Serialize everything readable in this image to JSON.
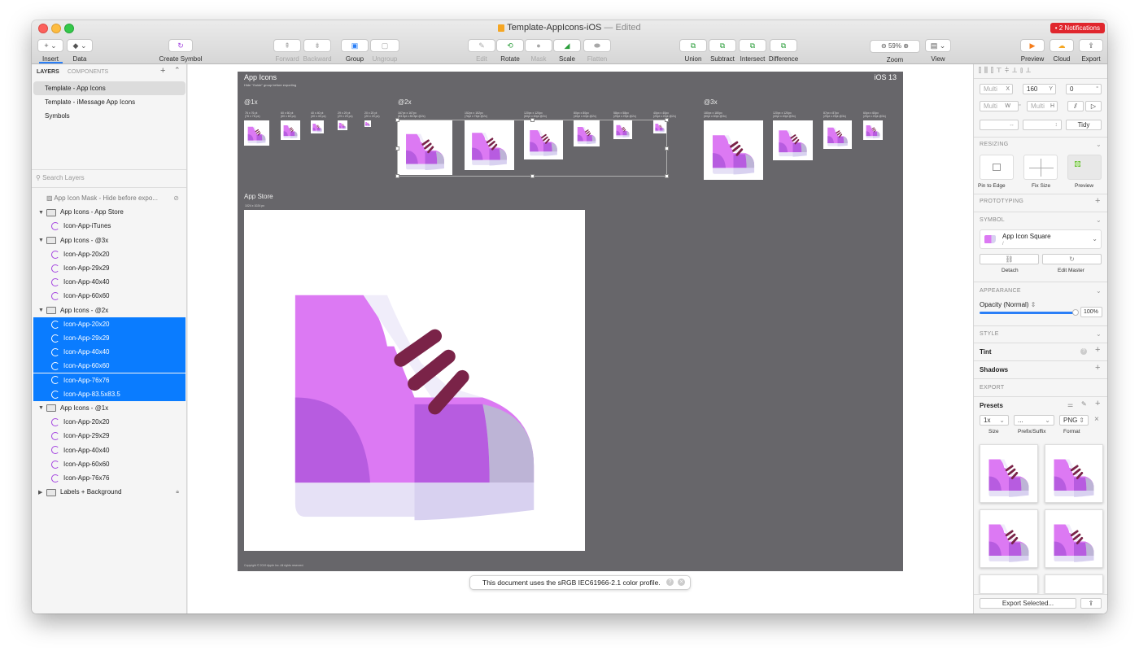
{
  "window": {
    "title": "Template-AppIcons-iOS",
    "edited": "— Edited",
    "notifications": "• 2 Notifications"
  },
  "toolbar": {
    "insert": "Insert",
    "data": "Data",
    "create_symbol": "Create Symbol",
    "forward": "Forward",
    "backward": "Backward",
    "group": "Group",
    "ungroup": "Ungroup",
    "edit": "Edit",
    "rotate": "Rotate",
    "mask": "Mask",
    "scale": "Scale",
    "flatten": "Flatten",
    "union": "Union",
    "subtract": "Subtract",
    "intersect": "Intersect",
    "difference": "Difference",
    "zoom_value": "59%",
    "zoom": "Zoom",
    "view": "View",
    "preview": "Preview",
    "cloud": "Cloud",
    "export": "Export"
  },
  "left": {
    "tab_layers": "LAYERS",
    "tab_components": "COMPONENTS",
    "pages": [
      "Template - App Icons",
      "Template - iMessage App Icons",
      "Symbols"
    ],
    "search_placeholder": "Search Layers",
    "layers": [
      {
        "label": "App Icon Mask - Hide before expo...",
        "kind": "mask",
        "indent": 0
      },
      {
        "label": "App Icons - App Store",
        "kind": "group",
        "indent": 0
      },
      {
        "label": "Icon-App-iTunes",
        "kind": "symbol",
        "indent": 1
      },
      {
        "label": "App Icons - @3x",
        "kind": "group",
        "indent": 0
      },
      {
        "label": "Icon-App-20x20",
        "kind": "symbol",
        "indent": 1
      },
      {
        "label": "Icon-App-29x29",
        "kind": "symbol",
        "indent": 1
      },
      {
        "label": "Icon-App-40x40",
        "kind": "symbol",
        "indent": 1
      },
      {
        "label": "Icon-App-60x60",
        "kind": "symbol",
        "indent": 1
      },
      {
        "label": "App Icons - @2x",
        "kind": "group",
        "indent": 0
      },
      {
        "label": "Icon-App-20x20",
        "kind": "symbol",
        "indent": 1,
        "selected": true
      },
      {
        "label": "Icon-App-29x29",
        "kind": "symbol",
        "indent": 1,
        "selected": true
      },
      {
        "label": "Icon-App-40x40",
        "kind": "symbol",
        "indent": 1,
        "selected": true
      },
      {
        "label": "Icon-App-60x60",
        "kind": "symbol",
        "indent": 1,
        "selected": true
      },
      {
        "label": "Icon-App-76x76",
        "kind": "symbol",
        "indent": 1,
        "selected": true
      },
      {
        "label": "Icon-App-83.5x83.5",
        "kind": "symbol",
        "indent": 1,
        "selected": true
      },
      {
        "label": "App Icons - @1x",
        "kind": "group",
        "indent": 0
      },
      {
        "label": "Icon-App-20x20",
        "kind": "symbol",
        "indent": 1
      },
      {
        "label": "Icon-App-29x29",
        "kind": "symbol",
        "indent": 1
      },
      {
        "label": "Icon-App-40x40",
        "kind": "symbol",
        "indent": 1
      },
      {
        "label": "Icon-App-60x60",
        "kind": "symbol",
        "indent": 1
      },
      {
        "label": "Icon-App-76x76",
        "kind": "symbol",
        "indent": 1
      },
      {
        "label": "Labels + Background",
        "kind": "group-closed",
        "indent": 0
      }
    ]
  },
  "canvas": {
    "artboard_title": "App Icons",
    "artboard_hint": "Hide \"Guide\" group before exporting",
    "ios": "iOS 13",
    "sec_1x": "@1x",
    "sec_2x": "@2x",
    "sec_3x": "@3x",
    "sec_store": "App Store",
    "size_1x": [
      "76 x 76 pt\n(76 x 76 px)",
      "60 x 60 pt\n(60 x 60 px)",
      "40 x 40 pt\n(40 x 40 px)",
      "29 x 29 pt\n(29 x 29 px)",
      "20 x 20 pt\n(20 x 20 px)"
    ],
    "size_2x": [
      "167px x 167px\n(83.5pt x 83.5pt @2x)",
      "152px x 152px\n(76pt x 76pt @2x)",
      "120px x 120px\n(60pt x 60pt @2x)",
      "80px x 80px\n(40pt x 40pt @2x)",
      "58px x 58px\n(29pt x 29pt @2x)",
      "40px x 40px\n(20pt x 20pt @2x)"
    ],
    "size_3x": [
      "180px x 180px\n(60pt x 60pt @3x)",
      "120px x 120px\n(40pt x 40pt @3x)",
      "87px x 87px\n(29pt x 29pt @3x)",
      "60px x 60px\n(20pt x 20pt @3x)"
    ],
    "size_store": "1024 x 1024 px",
    "copyright": "Copyright © 2019 Apple Inc. All rights reserved.",
    "toast": "This document uses the sRGB IEC61966-2.1 color profile."
  },
  "right": {
    "multi": "Multi",
    "x": "X",
    "y_val": "160",
    "y": "Y",
    "rot_val": "0",
    "rot": "°",
    "w": "W",
    "h": "H",
    "tidy": "Tidy",
    "resizing": "RESIZING",
    "pin_to_edge": "Pin to Edge",
    "fix_size": "Fix Size",
    "preview": "Preview",
    "prototyping": "PROTOTYPING",
    "symbol": "SYMBOL",
    "symbol_name": "App Icon Square",
    "symbol_path": "/",
    "detach": "Detach",
    "edit_master": "Edit Master",
    "appearance": "APPEARANCE",
    "opacity_label": "Opacity (Normal)",
    "opacity_value": "100%",
    "opacity_level": 1.0,
    "style": "STYLE",
    "tint": "Tint",
    "shadows": "Shadows",
    "export": "EXPORT",
    "presets": "Presets",
    "size_value": "1x",
    "prefix_value": "...",
    "format_value": "PNG",
    "size_label": "Size",
    "prefix_label": "Prefix/Suffix",
    "format_label": "Format",
    "export_selected": "Export Selected..."
  },
  "colors": {
    "accent": "#0a7cff",
    "artboard_bg": "#67666a",
    "shoe_pink": "#dc79f3",
    "shoe_purple": "#b75ce0",
    "lace": "#7a2348",
    "sole": "#e6e1f6",
    "heel": "#f0edfa",
    "toe": "#bdb4d6",
    "notif": "#e0262d",
    "play": "#f57c1a"
  }
}
